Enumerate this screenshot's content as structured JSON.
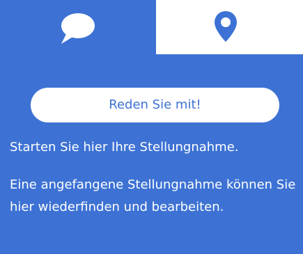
{
  "colors": {
    "accent": "#3d72d4",
    "surface": "#ffffff",
    "text_on_accent": "#ffffff"
  },
  "tabs": [
    {
      "icon": "speech-bubble-icon",
      "active": true
    },
    {
      "icon": "map-pin-icon",
      "active": false
    }
  ],
  "cta": {
    "label": "Reden Sie mit!"
  },
  "content": {
    "intro": "Starten Sie hier Ihre Stellungnahme.",
    "resume": "Eine angefangene Stellungnahme können Sie hier wiederfinden und bearbeiten."
  }
}
